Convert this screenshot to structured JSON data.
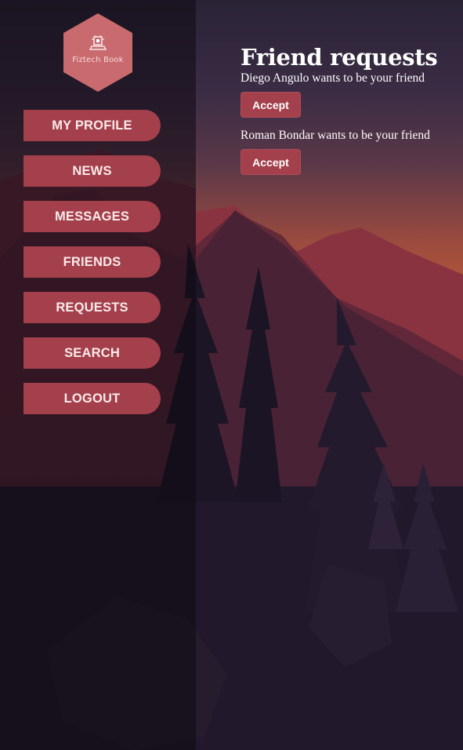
{
  "logo": {
    "text": "Fiztech Book",
    "icon": "laptop-chip-icon",
    "color": "#c96a6e"
  },
  "nav": {
    "items": [
      {
        "label": "MY PROFILE",
        "name": "nav-my-profile-button"
      },
      {
        "label": "NEWS",
        "name": "nav-news-button"
      },
      {
        "label": "MESSAGES",
        "name": "nav-messages-button"
      },
      {
        "label": "FRIENDS",
        "name": "nav-friends-button"
      },
      {
        "label": "REQUESTS",
        "name": "nav-requests-button"
      },
      {
        "label": "SEARCH",
        "name": "nav-search-button"
      },
      {
        "label": "LOGOUT",
        "name": "nav-logout-button"
      }
    ],
    "color": "#a3404c"
  },
  "main": {
    "title": "Friend requests",
    "requests": [
      {
        "text": "Diego Angulo wants to be your friend",
        "accept_label": "Accept"
      },
      {
        "text": "Roman Bondar wants to be your friend",
        "accept_label": "Accept"
      }
    ]
  },
  "theme": {
    "accent": "#a3404c",
    "sky_top": "#2b2338",
    "sky_bottom": "#c24d3c"
  }
}
